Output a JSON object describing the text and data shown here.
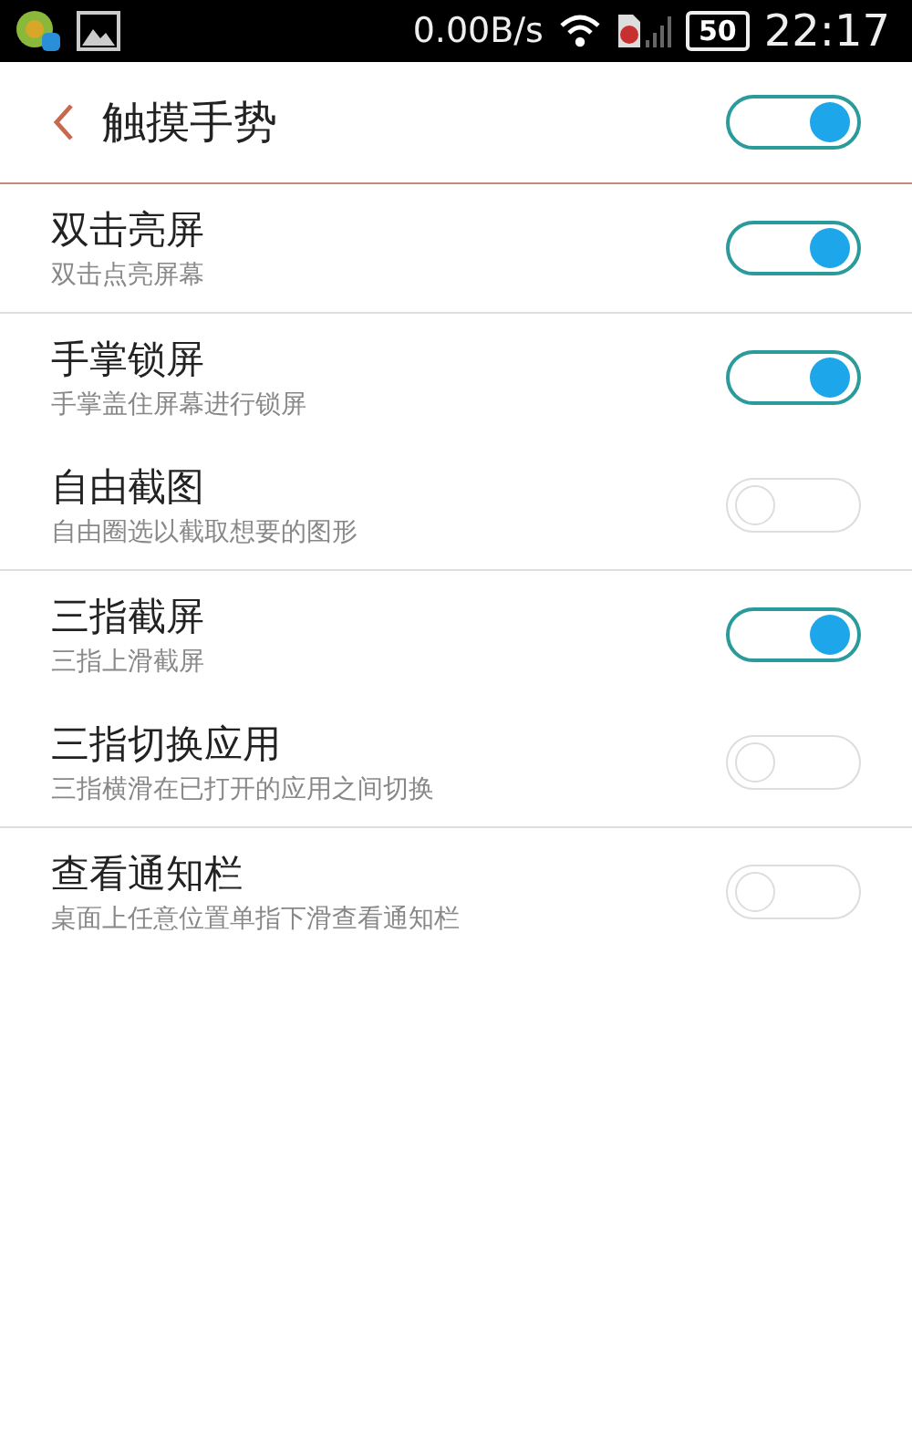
{
  "status_bar": {
    "speed": "0.00B/s",
    "battery": "50",
    "time": "22:17"
  },
  "header": {
    "title": "触摸手势",
    "on": true
  },
  "groups": [
    {
      "items": [
        {
          "title": "双击亮屏",
          "subtitle": "双击点亮屏幕",
          "on": true
        }
      ]
    },
    {
      "items": [
        {
          "title": "手掌锁屏",
          "subtitle": "手掌盖住屏幕进行锁屏",
          "on": true
        },
        {
          "title": "自由截图",
          "subtitle": "自由圈选以截取想要的图形",
          "on": false
        }
      ]
    },
    {
      "items": [
        {
          "title": "三指截屏",
          "subtitle": "三指上滑截屏",
          "on": true
        },
        {
          "title": "三指切换应用",
          "subtitle": "三指横滑在已打开的应用之间切换",
          "on": false
        }
      ]
    },
    {
      "items": [
        {
          "title": "查看通知栏",
          "subtitle": "桌面上任意位置单指下滑查看通知栏",
          "on": false
        }
      ]
    }
  ]
}
